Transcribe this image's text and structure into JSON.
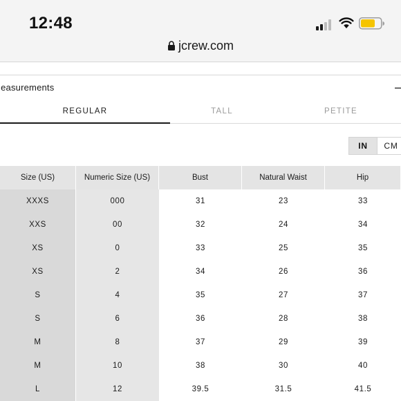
{
  "status_bar": {
    "time": "12:48",
    "signal_bars_filled": 2,
    "battery_color": "#f5c400"
  },
  "browser": {
    "url": "jcrew.com",
    "lock_icon": "lock-icon"
  },
  "section": {
    "title": "leasurements",
    "collapse_symbol": "–"
  },
  "tabs": [
    {
      "label": "REGULAR",
      "active": true
    },
    {
      "label": "TALL",
      "active": false
    },
    {
      "label": "PETITE",
      "active": false
    }
  ],
  "units": {
    "in_label": "IN",
    "cm_label": "CM",
    "selected": "IN"
  },
  "table": {
    "headers": [
      "Size (US)",
      "Numeric Size (US)",
      "Bust",
      "Natural Waist",
      "Hip"
    ],
    "rows": [
      [
        "XXXS",
        "000",
        "31",
        "23",
        "33"
      ],
      [
        "XXS",
        "00",
        "32",
        "24",
        "34"
      ],
      [
        "XS",
        "0",
        "33",
        "25",
        "35"
      ],
      [
        "XS",
        "2",
        "34",
        "26",
        "36"
      ],
      [
        "S",
        "4",
        "35",
        "27",
        "37"
      ],
      [
        "S",
        "6",
        "36",
        "28",
        "38"
      ],
      [
        "M",
        "8",
        "37",
        "29",
        "39"
      ],
      [
        "M",
        "10",
        "38",
        "30",
        "40"
      ],
      [
        "L",
        "12",
        "39.5",
        "31.5",
        "41.5"
      ]
    ]
  }
}
